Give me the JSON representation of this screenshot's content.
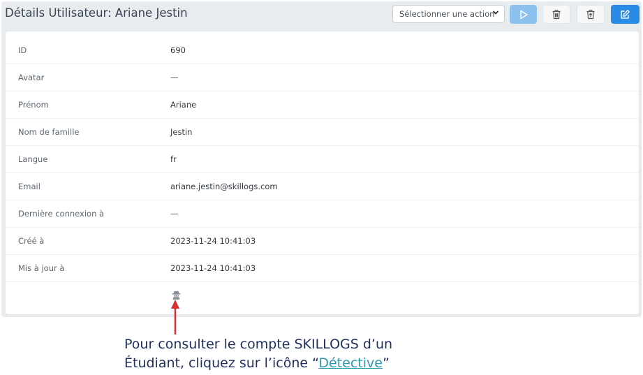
{
  "header": {
    "title": "Détails Utilisateur: Ariane Jestin",
    "action_select": {
      "value": "Sélectionner une action"
    }
  },
  "details": {
    "rows": [
      {
        "label": "ID",
        "value": "690"
      },
      {
        "label": "Avatar",
        "value": "—"
      },
      {
        "label": "Prénom",
        "value": "Ariane"
      },
      {
        "label": "Nom de famille",
        "value": "Jestin"
      },
      {
        "label": "Langue",
        "value": "fr"
      },
      {
        "label": "Email",
        "value": "ariane.jestin@skillogs.com"
      },
      {
        "label": "Dernière connexion à",
        "value": "—"
      },
      {
        "label": "Créé à",
        "value": "2023-11-24 10:41:03"
      },
      {
        "label": "Mis à jour à",
        "value": "2023-11-24 10:41:03"
      }
    ],
    "detective_icon": "detective-icon"
  },
  "annotation": {
    "line1": "Pour consulter le compte SKILLOGS d’un",
    "line2_prefix": "Étudiant, cliquez sur l’icône “",
    "line2_link": "Détective",
    "line2_suffix": "”"
  },
  "colors": {
    "play_button": "#8ec2ee",
    "edit_button": "#2a8be5",
    "arrow": "#d32f2f",
    "annotation_text": "#1f2f5c",
    "annotation_link": "#2a9ab0"
  }
}
